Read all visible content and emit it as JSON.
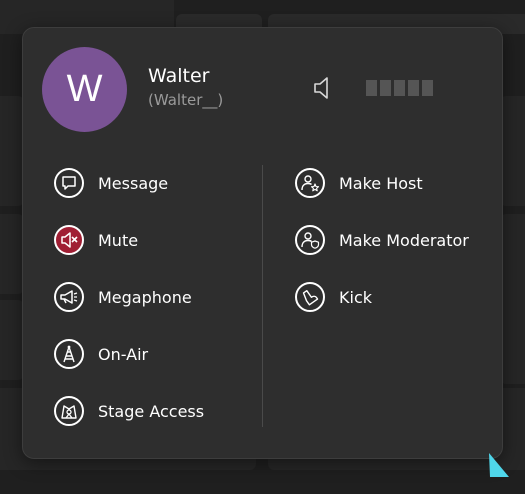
{
  "user": {
    "avatar_initial": "W",
    "name": "Walter",
    "handle": "(Walter__)"
  },
  "icons": {
    "speaker": "speaker-icon",
    "message": "chat-bubble-icon",
    "mute": "mute-icon",
    "megaphone": "megaphone-icon",
    "on_air": "antenna-icon",
    "stage_access": "stage-icon",
    "make_host": "user-star-icon",
    "make_moderator": "user-shield-icon",
    "kick": "boot-icon"
  },
  "volume": {
    "level": 0,
    "bars": 5
  },
  "actions_left": [
    {
      "label": "Message"
    },
    {
      "label": "Mute",
      "active": true
    },
    {
      "label": "Megaphone"
    },
    {
      "label": "On-Air"
    },
    {
      "label": "Stage Access"
    }
  ],
  "actions_right": [
    {
      "label": "Make Host"
    },
    {
      "label": "Make Moderator"
    },
    {
      "label": "Kick"
    }
  ],
  "colors": {
    "avatar": "#7a5395",
    "mute_active": "#a01f34",
    "panel": "#2e2e2e",
    "cursor": "#4fd6ea"
  }
}
